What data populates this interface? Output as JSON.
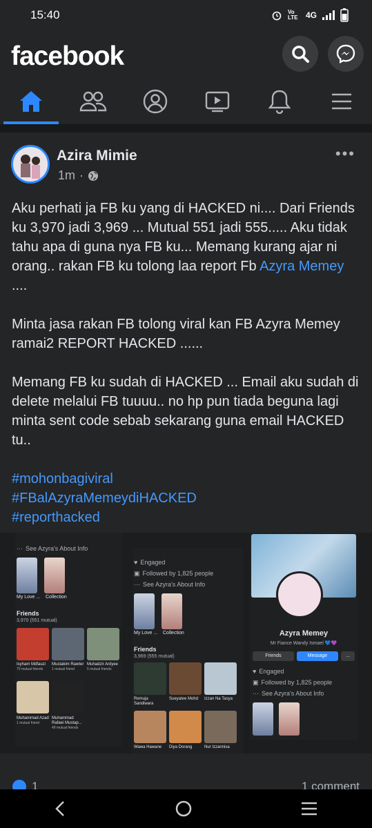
{
  "status": {
    "time": "15:40",
    "network": "4G",
    "volte": "Vo LTE"
  },
  "header": {
    "logo": "facebook"
  },
  "tabs": [
    "home",
    "friends",
    "profile",
    "watch",
    "notifications",
    "menu"
  ],
  "post": {
    "author": "Azira Mimie",
    "time": "1m",
    "p1_text": "Aku perhati ja FB ku yang di HACKED ni.... Dari Friends ku 3,970 jadi 3,969 ... Mutual 551 jadi 555..... Aku tidak tahu apa di guna nya FB ku... Memang kurang ajar ni orang.. rakan FB ku tolong laa report Fb ",
    "p1_link": "Azyra Memey",
    "p1_end": " ....",
    "p2": "Minta jasa rakan FB tolong viral kan FB Azyra Memey ramai2 REPORT HACKED ......",
    "p3": "Memang FB ku sudah di HACKED ... Email aku sudah di delete melalui FB tuuuu.. no hp pun tiada beguna lagi minta sent code sebab sekarang guna email HACKED tu..",
    "hashtags": [
      "#mohonbagiviral",
      "#FBalAzyraMemeydiHACKED",
      "#reporthacked"
    ],
    "reactions": "1",
    "comments": "1 comment"
  },
  "shot1": {
    "about": "See Azyra's About Info",
    "albums": [
      "My Love ...",
      "Collection"
    ],
    "friends_title": "Friends",
    "friends_count": "3,970 (551 mutual)",
    "friends": [
      {
        "name": "Isyham Mdfauzi",
        "mutual": "70 mutual friends"
      },
      {
        "name": "Mustakim Rawter",
        "mutual": "1 mutual friend"
      },
      {
        "name": "Muhadzir Ardyee",
        "mutual": "5 mutual friends"
      },
      {
        "name": "Muhammad Azad",
        "mutual": "1 mutual friend"
      },
      {
        "name": "Muhammad Rafaei Mustap...",
        "mutual": "49 mutual friends"
      }
    ]
  },
  "shot2": {
    "engaged": "Engaged",
    "followed": "Followed by 1,825 people",
    "about": "See Azyra's About Info",
    "albums": [
      "My Love ...",
      "Collection"
    ],
    "friends_title": "Friends",
    "friends_count": "3,969 (555 mutual)",
    "friends": [
      "Remuja Sandiwara",
      "Sueyatee Mohd",
      "Izzan Na Tasya",
      "Wawa Hawane",
      "Diya Dorang",
      "Nur Izzannisa"
    ]
  },
  "shot3": {
    "name": "Azyra Memey",
    "subtitle": "Mr Fiance Wandy Ismael 💙💜",
    "btn_friends": "Friends",
    "btn_message": "Message",
    "btn_more": "...",
    "engaged": "Engaged",
    "followed": "Followed by 1,825 people",
    "about": "See Azyra's About Info"
  },
  "colors": {
    "accent": "#2d88ff",
    "bg": "#18191a",
    "surface": "#242526",
    "link": "#4599ff"
  }
}
